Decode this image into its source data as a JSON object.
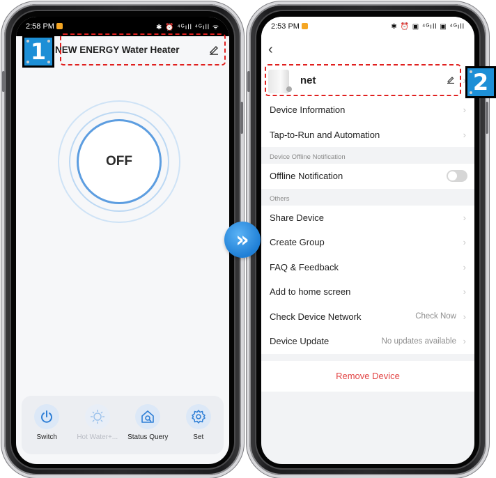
{
  "left": {
    "status_time": "2:58 PM",
    "status_icons": "✱ ⏰ ⁴ᴳıll ⁴ᴳıll ᯤ",
    "step_number": "1",
    "title": "NEW ENERGY Water Heater",
    "power_state": "OFF",
    "bottom_items": [
      {
        "label": "Switch",
        "icon": "power-icon",
        "enabled": true
      },
      {
        "label": "Hot Water+...",
        "icon": "boost-icon",
        "enabled": false
      },
      {
        "label": "Status Query",
        "icon": "home-search-icon",
        "enabled": true
      },
      {
        "label": "Set",
        "icon": "gear-icon",
        "enabled": true
      }
    ]
  },
  "right": {
    "status_time": "2:53 PM",
    "status_icons": "✱ ⏰ ▣ ⁴ᴳıll ▣ ⁴ᴳıll",
    "step_number": "2",
    "device_name": "net",
    "rows_top": [
      "Device Information",
      "Tap-to-Run and Automation"
    ],
    "offline_section_title": "Device Offline Notification",
    "offline_row": "Offline Notification",
    "others_section_title": "Others",
    "others_rows": [
      "Share Device",
      "Create Group",
      "FAQ & Feedback",
      "Add to home screen"
    ],
    "network_row": {
      "label": "Check Device Network",
      "value": "Check Now"
    },
    "update_row": {
      "label": "Device Update",
      "value": "No updates available"
    },
    "remove_label": "Remove Device"
  },
  "colors": {
    "accent_blue": "#1d8fd6",
    "highlight_red": "#e0201f",
    "dial_blue": "#5c9de0",
    "remove_red": "#e24545"
  }
}
